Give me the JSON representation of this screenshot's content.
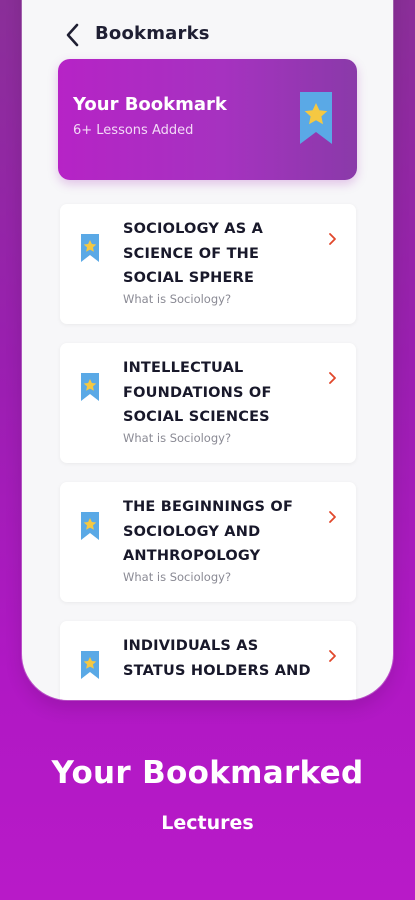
{
  "header": {
    "title": "Bookmarks",
    "back_icon": "chevron-left-icon"
  },
  "banner": {
    "title": "Your Bookmark",
    "subtitle": "6+ Lessons Added",
    "icon": "bookmark-star-icon"
  },
  "lessons": [
    {
      "title": "SOCIOLOGY AS A SCIENCE OF THE SOCIAL SPHERE",
      "subtitle": "What is Sociology?",
      "icon": "bookmark-star-icon"
    },
    {
      "title": "INTELLECTUAL FOUNDATIONS OF SOCIAL SCIENCES",
      "subtitle": "What is Sociology?",
      "icon": "bookmark-star-icon"
    },
    {
      "title": "THE BEGINNINGS OF SOCIOLOGY AND ANTHROPOLOGY",
      "subtitle": "What is Sociology?",
      "icon": "bookmark-star-icon"
    },
    {
      "title": "INDIVIDUALS AS STATUS HOLDERS AND",
      "subtitle": "",
      "icon": "bookmark-star-icon"
    }
  ],
  "caption": {
    "title": "Your Bookmarked",
    "subtitle": "Lectures"
  },
  "colors": {
    "accent": "#b623c6",
    "chevron": "#e1472b",
    "bookmark_blue": "#5aa9e6",
    "star_yellow": "#f5c842"
  }
}
